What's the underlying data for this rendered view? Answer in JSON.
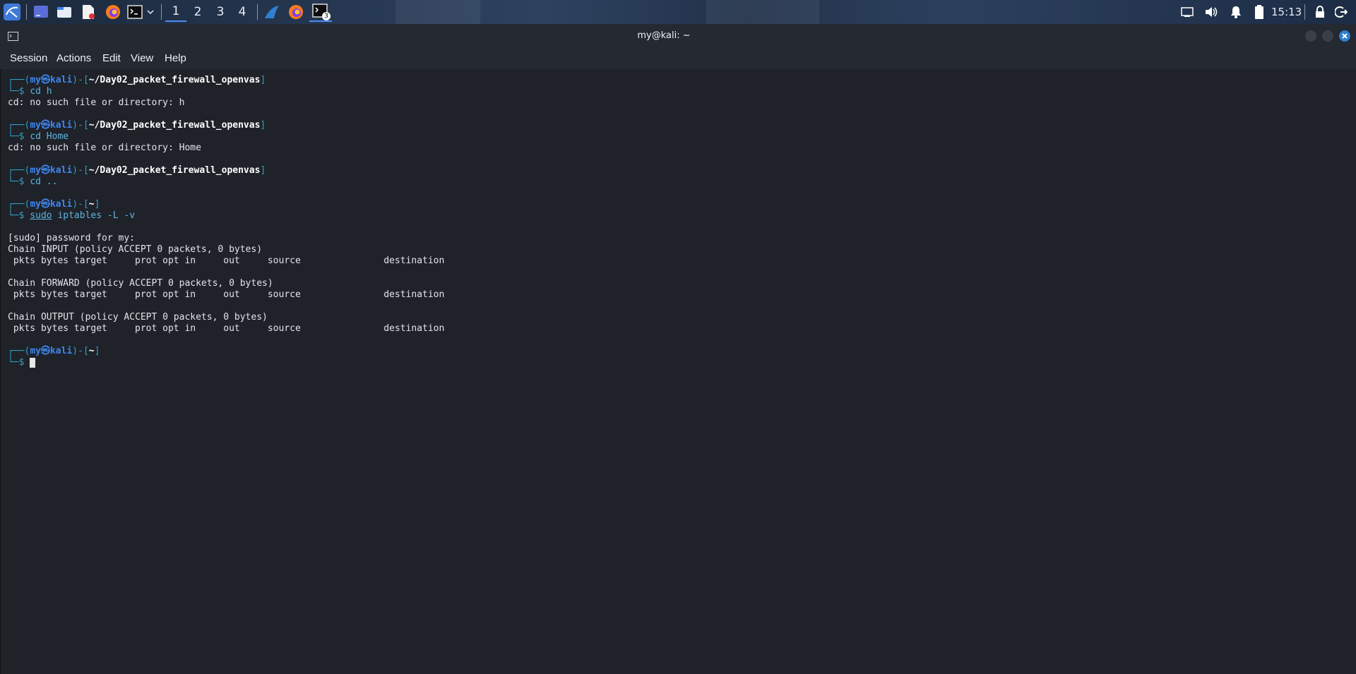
{
  "panel": {
    "workspaces": [
      "1",
      "2",
      "3",
      "4"
    ],
    "active_workspace": "1",
    "clock": "15:13",
    "terminal_badge": "3",
    "icons": [
      "kali-menu-icon",
      "desktop-icon",
      "file-manager-icon",
      "text-editor-icon",
      "firefox-icon",
      "terminal-icon",
      "chevron-down-icon",
      "app-launcher-icon",
      "firefox-icon",
      "terminal-icon",
      "screen-icon",
      "volume-icon",
      "bell-icon",
      "battery-icon",
      "lock-icon",
      "logout-icon"
    ]
  },
  "window": {
    "title": "my@kali: ~",
    "menu": [
      "Session",
      "Actions",
      "Edit",
      "View",
      "Help"
    ]
  },
  "terminal": {
    "user": "my",
    "host": "kali",
    "cwd1": "~/Day02_packet_firewall_openvas",
    "cwd2": "~",
    "cmd_cd_h": "cd h",
    "err_h": "cd: no such file or directory: h",
    "cmd_cd_home": "cd Home",
    "err_home": "cd: no such file or directory: Home",
    "cmd_cd_up": "cd ..",
    "cmd_sudo": "sudo",
    "cmd_iptables": " iptables -L -v",
    "sudo_prompt": "[sudo] password for my:",
    "chain_input": "Chain INPUT (policy ACCEPT 0 packets, 0 bytes)",
    "chain_forward": "Chain FORWARD (policy ACCEPT 0 packets, 0 bytes)",
    "chain_output": "Chain OUTPUT (policy ACCEPT 0 packets, 0 bytes)",
    "table_header": " pkts bytes target     prot opt in     out     source               destination"
  },
  "colors": {
    "prompt_frame": "#2f9ec5",
    "prompt_user": "#3d86f0",
    "background": "#1f2229"
  }
}
